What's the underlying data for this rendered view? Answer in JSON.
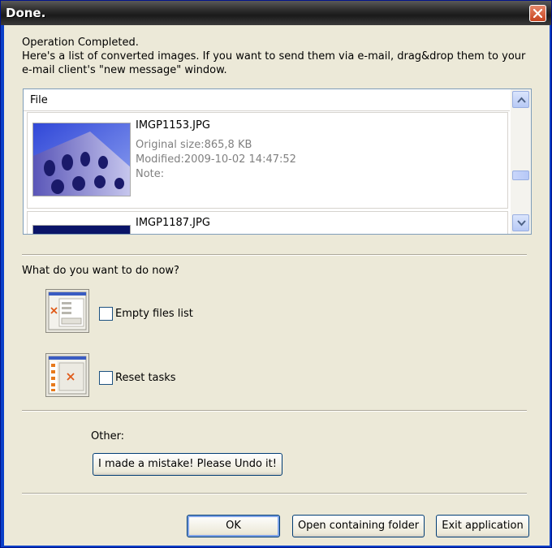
{
  "window": {
    "title": "Done."
  },
  "intro": {
    "line1": "Operation Completed.",
    "line2": "Here's a list of converted images. If you want to send them via e-mail, drag&drop them to your",
    "line3": "e-mail client's \"new message\" window."
  },
  "list": {
    "column_header": "File",
    "items": [
      {
        "filename": "IMGP1153.JPG",
        "original_size": "Original size:865,8 KB",
        "modified": "Modified:2009-10-02 14:47:52",
        "note": "Note:"
      },
      {
        "filename": "IMGP1187.JPG"
      }
    ]
  },
  "question": "What do you want to do now?",
  "options": [
    {
      "label": "Empty files list",
      "checked": false,
      "icon": "empty-list-icon"
    },
    {
      "label": "Reset tasks",
      "checked": false,
      "icon": "reset-tasks-icon"
    }
  ],
  "other": {
    "label": "Other:",
    "undo_button": "I made a mistake! Please Undo it!"
  },
  "buttons": {
    "ok": "OK",
    "open_folder": "Open containing folder",
    "exit": "Exit application"
  }
}
